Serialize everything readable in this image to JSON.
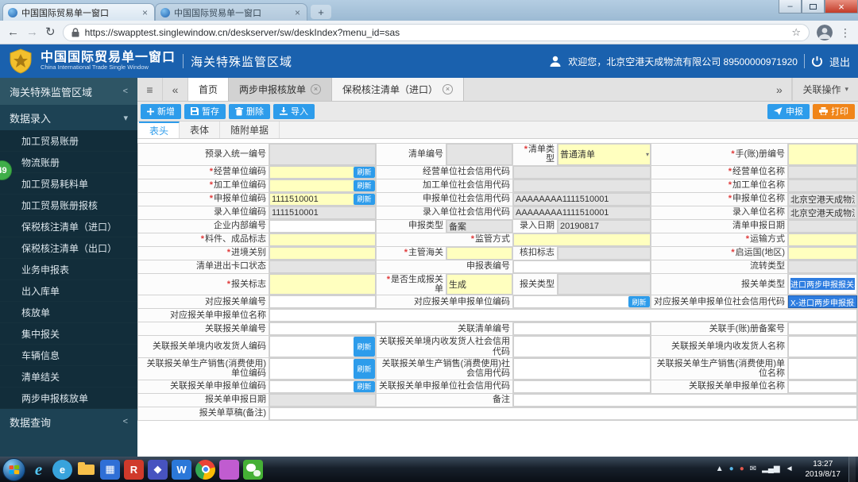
{
  "browser": {
    "tabs": [
      {
        "title": "中国国际贸易单一窗口"
      },
      {
        "title": "中国国际贸易单一窗口"
      }
    ],
    "url": "https://swapptest.singlewindow.cn/deskserver/sw/deskIndex?menu_id=sas"
  },
  "header": {
    "title": "中国国际贸易单一窗口",
    "subtitle": "China International Trade Single Window",
    "section": "海关特殊监管区域",
    "welcome": "欢迎您，北京空港天成物流有限公司 89500000971920",
    "logout": "退出"
  },
  "sidebar": {
    "root": "海关特殊监管区域",
    "group_entry": "数据录入",
    "group_query": "数据查询",
    "badge": "49",
    "items": [
      "加工贸易账册",
      "物流账册",
      "加工贸易耗料单",
      "加工贸易账册报核",
      "保税核注清单（进口）",
      "保税核注清单（出口）",
      "业务申报表",
      "出入库单",
      "核放单",
      "集中报关",
      "车辆信息",
      "清单结关",
      "两步申报核放单"
    ]
  },
  "tabs": {
    "more_label": "关联操作",
    "items": [
      {
        "label": "首页",
        "closable": false,
        "active": false
      },
      {
        "label": "两步申报核放单",
        "closable": true,
        "active": false
      },
      {
        "label": "保税核注清单（进口）",
        "closable": true,
        "active": true
      }
    ]
  },
  "toolbar": {
    "add": "新增",
    "save": "暂存",
    "del": "删除",
    "imp": "导入",
    "declare": "申报",
    "print": "打印",
    "refresh": "刷新"
  },
  "subtabs": [
    {
      "label": "表头",
      "active": true
    },
    {
      "label": "表体",
      "active": false
    },
    {
      "label": "随附单据",
      "active": false
    }
  ],
  "form": {
    "required_marker": "*",
    "rows": [
      {
        "cells": [
          {
            "l": "预录入统一编号"
          },
          {
            "f": "gray"
          },
          {
            "l": "清单编号"
          },
          {
            "f": "gray"
          },
          {
            "l": "清单类型",
            "r": 1
          },
          {
            "f": "yellow",
            "v": "普通清单",
            "dd": 1
          },
          {
            "l": "手(账)册编号",
            "r": 1
          },
          {
            "f": "yellow"
          }
        ]
      },
      {
        "cells": [
          {
            "l": "经营单位编码",
            "r": 1
          },
          {
            "f": "yellow",
            "rf": 1
          },
          {
            "l": "经营单位社会信用代码",
            "s": 2
          },
          {
            "f": "gray",
            "fs": 2
          },
          {
            "l": "经营单位名称",
            "r": 1
          },
          {
            "f": "gray"
          }
        ]
      },
      {
        "cells": [
          {
            "l": "加工单位编码",
            "r": 1
          },
          {
            "f": "yellow",
            "rf": 1
          },
          {
            "l": "加工单位社会信用代码",
            "s": 2
          },
          {
            "f": "gray",
            "fs": 2
          },
          {
            "l": "加工单位名称",
            "r": 1
          },
          {
            "f": "gray"
          }
        ]
      },
      {
        "cells": [
          {
            "l": "申报单位编码",
            "r": 1
          },
          {
            "f": "yellow",
            "v": "1111510001",
            "rf": 1
          },
          {
            "l": "申报单位社会信用代码",
            "s": 2
          },
          {
            "f": "gray",
            "fs": 2,
            "v": "AAAAAAAA1111510001"
          },
          {
            "l": "申报单位名称",
            "r": 1
          },
          {
            "f": "gray",
            "v": "北京空港天成物流有限公司"
          }
        ]
      },
      {
        "cells": [
          {
            "l": "录入单位编码"
          },
          {
            "f": "gray",
            "v": "1111510001"
          },
          {
            "l": "录入单位社会信用代码",
            "s": 2
          },
          {
            "f": "gray",
            "fs": 2,
            "v": "AAAAAAAA1111510001"
          },
          {
            "l": "录入单位名称"
          },
          {
            "f": "gray",
            "v": "北京空港天成物流有限公司"
          }
        ]
      },
      {
        "cells": [
          {
            "l": "企业内部编号"
          },
          {
            "f": "white"
          },
          {
            "l": "申报类型"
          },
          {
            "f": "gray",
            "v": "备案"
          },
          {
            "l": "录入日期"
          },
          {
            "f": "gray",
            "v": "20190817"
          },
          {
            "l": "清单申报日期"
          },
          {
            "f": "gray"
          }
        ]
      },
      {
        "cells": [
          {
            "l": "料件、成品标志",
            "r": 1
          },
          {
            "f": "yellow"
          },
          {
            "l": "监管方式",
            "r": 1,
            "s": 2
          },
          {
            "f": "yellow",
            "fs": 2
          },
          {
            "l": "运输方式",
            "r": 1
          },
          {
            "f": "yellow"
          }
        ]
      },
      {
        "cells": [
          {
            "l": "进境关别",
            "r": 1
          },
          {
            "f": "yellow"
          },
          {
            "l": "主管海关",
            "r": 1
          },
          {
            "f": "yellow"
          },
          {
            "l": "核扣标志"
          },
          {
            "f": "gray"
          },
          {
            "l": "启运国(地区)",
            "r": 1
          },
          {
            "f": "yellow"
          }
        ]
      },
      {
        "cells": [
          {
            "l": "清单进出卡口状态"
          },
          {
            "f": "gray"
          },
          {
            "l": "申报表编号",
            "s": 2
          },
          {
            "f": "white",
            "fs": 2
          },
          {
            "l": "流转类型"
          },
          {
            "f": "gray"
          }
        ]
      },
      {
        "cells": [
          {
            "l": "报关标志",
            "r": 1
          },
          {
            "f": "yellow"
          },
          {
            "l": "是否生成报关单",
            "r": 1
          },
          {
            "f": "yellow",
            "v": "生成"
          },
          {
            "l": "报关类型"
          },
          {
            "f": "gray"
          },
          {
            "l": "报关单类型"
          },
          {
            "f": "sel",
            "v": "进口两步申报报关单"
          }
        ]
      },
      {
        "cells": [
          {
            "l": "对应报关单编号"
          },
          {
            "f": "white"
          },
          {
            "l": "对应报关单申报单位编码",
            "s": 2
          },
          {
            "f": "white",
            "fs": 2,
            "rf": 1
          },
          {
            "l": "对应报关单申报单位社会信用代码"
          },
          {
            "f": "opt",
            "v": "X-进口两步申报报关单"
          }
        ]
      },
      {
        "cells": [
          {
            "l": "对应报关单申报单位名称"
          },
          {
            "f": "white",
            "fs": 7
          }
        ]
      },
      {
        "cells": [
          {
            "l": "关联报关单编号"
          },
          {
            "f": "white"
          },
          {
            "l": "关联清单编号",
            "s": 2
          },
          {
            "f": "white",
            "fs": 2
          },
          {
            "l": "关联手(账)册备案号"
          },
          {
            "f": "white"
          }
        ]
      },
      {
        "cells": [
          {
            "l": "关联报关单境内收发货人编码"
          },
          {
            "f": "white",
            "rf": 1
          },
          {
            "l": "关联报关单境内收发货人社会信用代码",
            "s": 2
          },
          {
            "f": "white",
            "fs": 2
          },
          {
            "l": "关联报关单境内收发货人名称"
          },
          {
            "f": "white"
          }
        ]
      },
      {
        "cells": [
          {
            "l": "关联报关单生产销售(消费使用)单位编码"
          },
          {
            "f": "white",
            "rf": 1
          },
          {
            "l": "关联报关单生产销售(消费使用)社会信用代码",
            "s": 2
          },
          {
            "f": "white",
            "fs": 2
          },
          {
            "l": "关联报关单生产销售(消费使用)单位名称"
          },
          {
            "f": "white"
          }
        ]
      },
      {
        "cells": [
          {
            "l": "关联报关单申报单位编码"
          },
          {
            "f": "white",
            "rf": 1
          },
          {
            "l": "关联报关单申报单位社会信用代码",
            "s": 2
          },
          {
            "f": "white",
            "fs": 2
          },
          {
            "l": "关联报关单申报单位名称"
          },
          {
            "f": "white"
          }
        ]
      },
      {
        "cells": [
          {
            "l": "报关单申报日期"
          },
          {
            "f": "gray"
          },
          {
            "l": "备注",
            "s": 2
          },
          {
            "f": "white",
            "fs": 4
          }
        ]
      },
      {
        "cells": [
          {
            "l": "报关单草稿(备注)"
          },
          {
            "f": "white",
            "fs": 7
          }
        ]
      }
    ]
  },
  "taskbar": {
    "time": "13:27",
    "date": "2019/8/17",
    "icons": [
      {
        "name": "internet-explorer-icon",
        "type": "ie",
        "glyph": "e"
      },
      {
        "name": "browser-app-icon",
        "type": "circle",
        "bg": "#38a3dc",
        "glyph": "e"
      },
      {
        "name": "folder-explorer-icon",
        "type": "folder"
      },
      {
        "name": "media-app-icon",
        "type": "tile",
        "bg": "#2f6fd6",
        "glyph": "▦"
      },
      {
        "name": "app-icon-r",
        "type": "tile",
        "bg": "#d03a2b",
        "glyph": "R"
      },
      {
        "name": "app-icon-indigo",
        "type": "tile",
        "bg": "#4753c0",
        "glyph": "◆"
      },
      {
        "name": "app-icon-w",
        "type": "tile",
        "bg": "#2b78d9",
        "glyph": "W"
      },
      {
        "name": "chrome-icon",
        "type": "chrome"
      },
      {
        "name": "paint-app-icon",
        "type": "tile",
        "bg": "#c05cd0",
        "glyph": ""
      },
      {
        "name": "wechat-icon",
        "type": "wechat"
      }
    ],
    "tray": [
      {
        "name": "tray-expand-icon",
        "glyph": "▲",
        "color": "#dfe7ee"
      },
      {
        "name": "tray-app-icon-blue",
        "glyph": "●",
        "color": "#58b7e8"
      },
      {
        "name": "tray-app-icon-red",
        "glyph": "●",
        "color": "#e2574c"
      },
      {
        "name": "tray-mail-icon",
        "glyph": "✉",
        "color": "#e8eef4"
      },
      {
        "name": "network-icon",
        "glyph": "▂▄▆",
        "color": "#e8eef4"
      },
      {
        "name": "volume-icon",
        "glyph": "◄",
        "color": "#e8eef4"
      }
    ]
  },
  "icons": {
    "close": "×",
    "newtab": "+",
    "menu": "≡",
    "left": "«",
    "right": "»",
    "caret": "▾",
    "collapse": "<",
    "back": "←",
    "forward": "→",
    "reload": "↻",
    "star": "☆",
    "dots": "⋮",
    "min": "–"
  }
}
